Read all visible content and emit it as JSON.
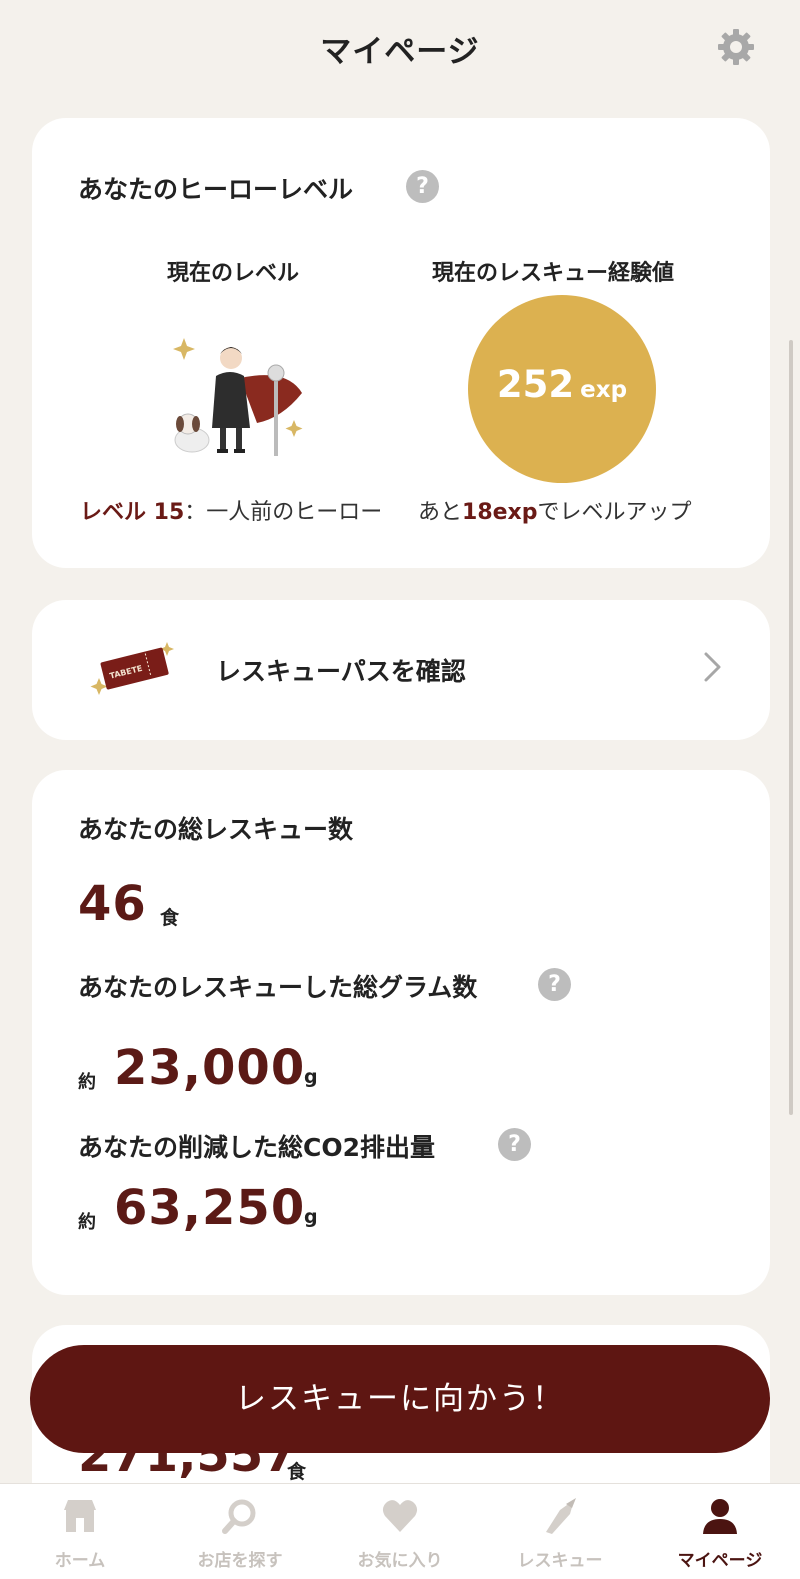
{
  "header": {
    "title": "マイページ",
    "settings_icon": "gear-icon"
  },
  "hero_card": {
    "title": "あなたのヒーローレベル",
    "help_mark": "?",
    "current_level_label": "現在のレベル",
    "current_exp_label": "現在のレスキュー経験値",
    "exp_value": "252",
    "exp_unit": "exp",
    "level_prefix": "レベル 15",
    "level_suffix": "：一人前のヒーロー",
    "next_prefix": "あと",
    "next_value": "18exp",
    "next_suffix": "でレベルアップ"
  },
  "pass_card": {
    "label": "レスキューパスを確認",
    "ticket_text": "TABETE"
  },
  "stats_card": {
    "total_rescue_label": "あなたの総レスキュー数",
    "total_rescue_value": "46",
    "total_rescue_unit": "食",
    "total_grams_label": "あなたのレスキューした総グラム数",
    "total_grams_prefix": "約",
    "total_grams_value": "23,000",
    "total_grams_unit": "g",
    "co2_label": "あなたの削減した総CO2排出量",
    "co2_prefix": "約",
    "co2_value": "63,250",
    "co2_unit": "g",
    "help_mark": "?"
  },
  "next_card": {
    "value": "271,557",
    "unit": "食"
  },
  "cta": {
    "label": "レスキューに向かう！"
  },
  "tabbar": {
    "items": [
      {
        "label": "ホーム",
        "icon": "shop-icon"
      },
      {
        "label": "お店を探す",
        "icon": "search-icon"
      },
      {
        "label": "お気に入り",
        "icon": "heart-icon"
      },
      {
        "label": "レスキュー",
        "icon": "rescue-icon"
      },
      {
        "label": "マイページ",
        "icon": "user-icon",
        "active": true
      }
    ]
  },
  "colors": {
    "accent_brown": "#5e1612",
    "exp_gold": "#dcb150",
    "background": "#f4f1ec"
  }
}
